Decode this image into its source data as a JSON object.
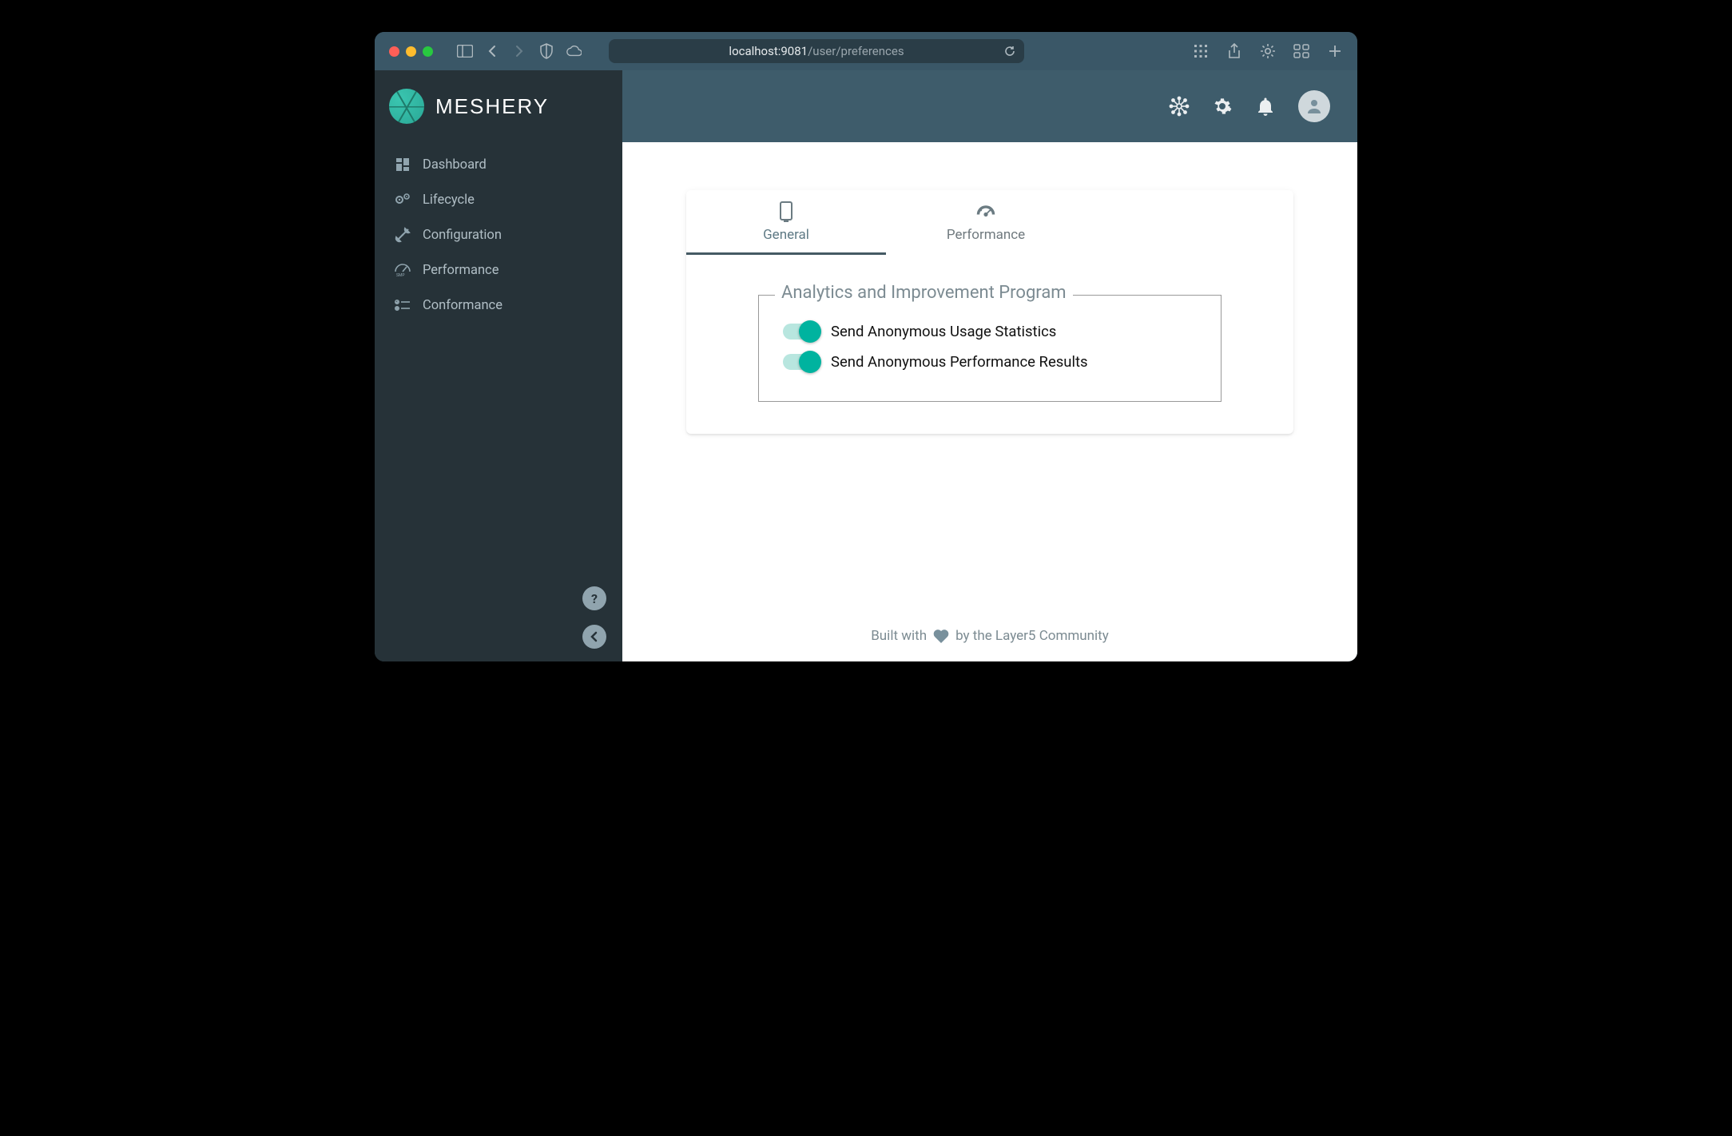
{
  "browser": {
    "url_host": "localhost:9081",
    "url_path": "/user/preferences"
  },
  "app": {
    "brand": "MESHERY",
    "sidebar": {
      "items": [
        {
          "label": "Dashboard",
          "icon": "dashboard-icon"
        },
        {
          "label": "Lifecycle",
          "icon": "gears-icon"
        },
        {
          "label": "Configuration",
          "icon": "wrench-icon"
        },
        {
          "label": "Performance",
          "icon": "gauge-smp-icon"
        },
        {
          "label": "Conformance",
          "icon": "checklist-icon"
        }
      ],
      "help_tooltip": "?",
      "collapse_tooltip": "‹"
    },
    "topbar": {
      "icons": [
        "mesh-icon",
        "gear-icon",
        "bell-icon",
        "user-avatar"
      ]
    },
    "tabs": [
      {
        "label": "General",
        "icon": "device-icon",
        "active": true
      },
      {
        "label": "Performance",
        "icon": "speedometer-icon",
        "active": false
      }
    ],
    "panel": {
      "title": "Analytics and Improvement Program",
      "toggles": [
        {
          "label": "Send Anonymous Usage Statistics",
          "on": true
        },
        {
          "label": "Send Anonymous Performance Results",
          "on": true
        }
      ]
    },
    "footer": {
      "pre": "Built with",
      "post": "by the Layer5 Community"
    }
  }
}
